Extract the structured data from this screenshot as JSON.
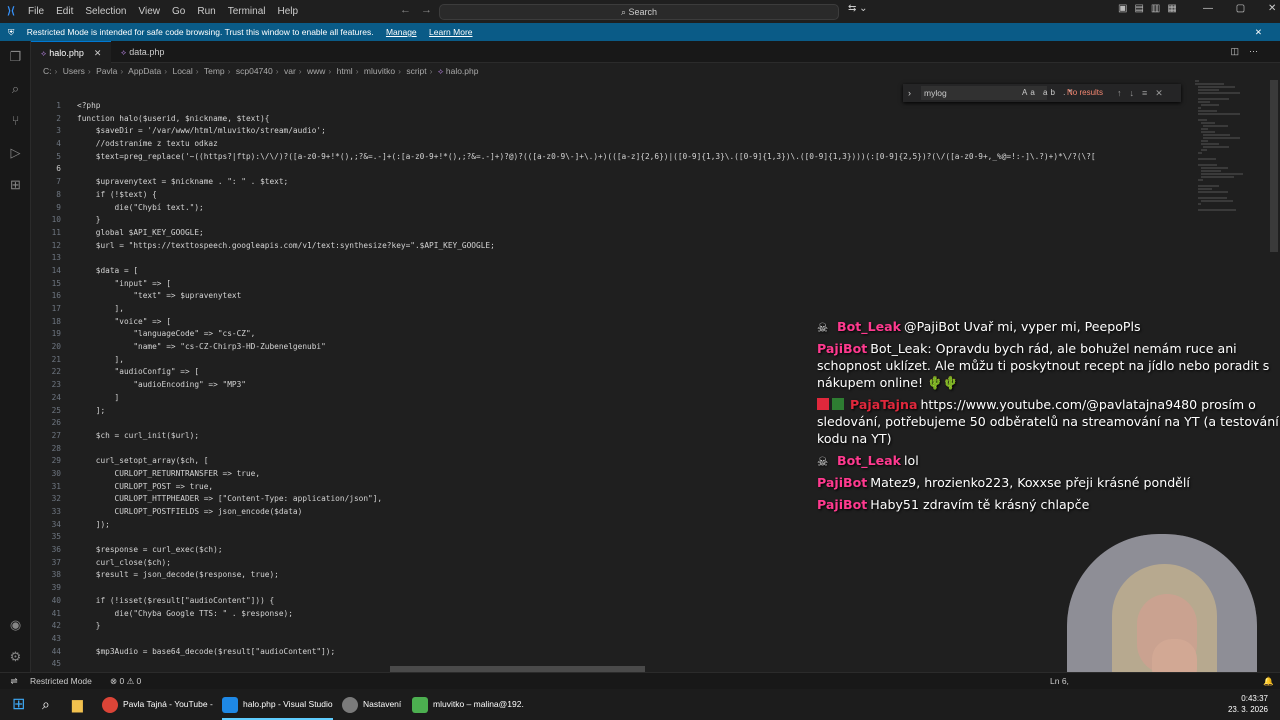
{
  "titlebar": {
    "menu": [
      "File",
      "Edit",
      "Selection",
      "View",
      "Go",
      "Run",
      "Terminal",
      "Help"
    ],
    "search_label": "Search"
  },
  "banner": {
    "text": "Restricted Mode is intended for safe code browsing. Trust this window to enable all features.",
    "manage": "Manage",
    "learn_more": "Learn More"
  },
  "tabs": [
    {
      "label": "halo.php",
      "active": true
    },
    {
      "label": "data.php",
      "active": false
    }
  ],
  "breadcrumb": [
    "C:",
    "Users",
    "Pavla",
    "AppData",
    "Local",
    "Temp",
    "scp04740",
    "var",
    "www",
    "html",
    "mluvitko",
    "script",
    "halo.php"
  ],
  "find": {
    "query": "mylog",
    "result": "No results",
    "options": "Aa ab .*"
  },
  "code_lines": [
    "<?php",
    "function halo($userid, $nickname, $text){",
    "    $saveDir = '/var/www/html/mluvitko/stream/audio';",
    "    //odstraníme z textu odkaz",
    "    $text=preg_replace('~((https?|ftp):\\/\\/)?([a-z0-9+!*(),;?&=.-]+(:[a-z0-9+!*(),;?&=.-]+)?@)?(([a-z0-9\\-]+\\.)+)(([a-z]{2,6})|([0-9]{1,3}\\.([0-9]{1,3})\\.([0-9]{1,3})))(:[0-9]{2,5})?(\\/([a-z0-9+,_%@=!:-]\\.?)+)*\\/?(\\?[",
    "",
    "    $upravenytext = $nickname . \": \" . $text;",
    "    if (!$text) {",
    "        die(\"Chybí text.\");",
    "    }",
    "    global $API_KEY_GOOGLE;",
    "    $url = \"https://texttospeech.googleapis.com/v1/text:synthesize?key=\".$API_KEY_GOOGLE;",
    "",
    "    $data = [",
    "        \"input\" => [",
    "            \"text\" => $upravenytext",
    "        ],",
    "        \"voice\" => [",
    "            \"languageCode\" => \"cs-CZ\",",
    "            \"name\" => \"cs-CZ-Chirp3-HD-Zubenelgenubi\"",
    "        ],",
    "        \"audioConfig\" => [",
    "            \"audioEncoding\" => \"MP3\"",
    "        ]",
    "    ];",
    "",
    "    $ch = curl_init($url);",
    "",
    "    curl_setopt_array($ch, [",
    "        CURLOPT_RETURNTRANSFER => true,",
    "        CURLOPT_POST => true,",
    "        CURLOPT_HTTPHEADER => [\"Content-Type: application/json\"],",
    "        CURLOPT_POSTFIELDS => json_encode($data)",
    "    ]);",
    "",
    "    $response = curl_exec($ch);",
    "    curl_close($ch);",
    "    $result = json_decode($response, true);",
    "",
    "    if (!isset($result[\"audioContent\"])) {",
    "        die(\"Chyba Google TTS: \" . $response);",
    "    }",
    "",
    "    $mp3Audio = base64_decode($result[\"audioContent\"]);",
    ""
  ],
  "chat": [
    {
      "author": "Bot_Leak",
      "color": "#ff3a8f",
      "badge": "skull",
      "text": "@PajiBot Uvař mi, vyper mi, PeepoPls"
    },
    {
      "author": "PajiBot",
      "color": "#ff3a8f",
      "badge": "",
      "text": "Bot_Leak: Opravdu bych rád, ale bohužel nemám ruce ani schopnost uklízet. Ale můžu ti poskytnout recept na jídlo nebo poradit s nákupem online! 🌵🌵"
    },
    {
      "author": "PajaTajna",
      "color": "#e0283c",
      "badge": "cam",
      "text": "https://www.youtube.com/@pavlatajna9480 prosím o sledování, potřebujeme 50 odběratelů na streamování na YT (a testování kodu na YT)"
    },
    {
      "author": "Bot_Leak",
      "color": "#ff3a8f",
      "badge": "skull",
      "text": "lol"
    },
    {
      "author": "PajiBot",
      "color": "#ff3a8f",
      "badge": "",
      "text": "Matez9, hrozienko223, Koxxse přeji krásné pondělí"
    },
    {
      "author": "PajiBot",
      "color": "#ff3a8f",
      "badge": "",
      "text": "Haby51 zdravím tě krásný chlapče"
    }
  ],
  "statusbar": {
    "restricted": "Restricted Mode",
    "problems": "⊗ 0 ⚠ 0",
    "position": "Ln 6,"
  },
  "taskbar": {
    "items": [
      {
        "label": "Pavla Tajná - YouTube -",
        "icon": "chrome-icon"
      },
      {
        "label": "halo.php - Visual Studio",
        "icon": "vscode-icon"
      },
      {
        "label": "Nastavení",
        "icon": "settings-icon"
      },
      {
        "label": "mluvitko – malina@192.",
        "icon": "winscp-icon"
      }
    ],
    "time": "0:43:37",
    "date": "23. 3. 2026"
  }
}
